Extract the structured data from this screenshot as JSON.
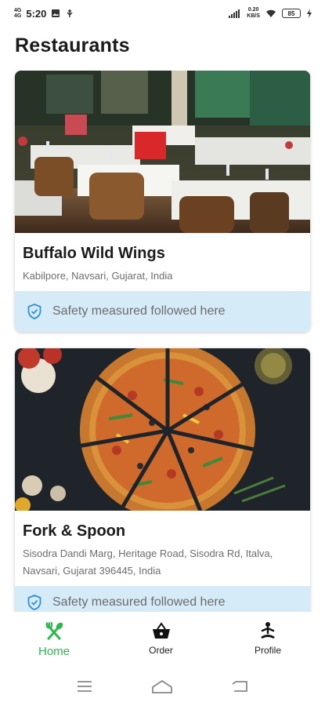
{
  "status_bar": {
    "network_top": "4G",
    "network_bottom": "4G",
    "time": "5:20",
    "speed_value": "0.20",
    "speed_unit": "KB/S",
    "battery": "85"
  },
  "header": {
    "title": "Restaurants"
  },
  "restaurants": [
    {
      "name": "Buffalo Wild Wings",
      "address": "Kabilpore, Navsari, Gujarat, India",
      "safety_text": "Safety measured followed here"
    },
    {
      "name": "Fork & Spoon",
      "address": "Sisodra Dandi Marg, Heritage Road, Sisodra Rd, Italva, Navsari, Gujarat 396445, India",
      "safety_text": "Safety measured followed here"
    }
  ],
  "bottom_nav": {
    "items": [
      {
        "label": "Home",
        "icon": "fork-spoon-icon",
        "active": true
      },
      {
        "label": "Order",
        "icon": "basket-icon",
        "active": false
      },
      {
        "label": "Profile",
        "icon": "meditation-person-icon",
        "active": false
      }
    ],
    "active_color": "#2db84b"
  },
  "colors": {
    "safety_banner": "#d6ebf8",
    "shield_icon": "#2f8fd8"
  }
}
